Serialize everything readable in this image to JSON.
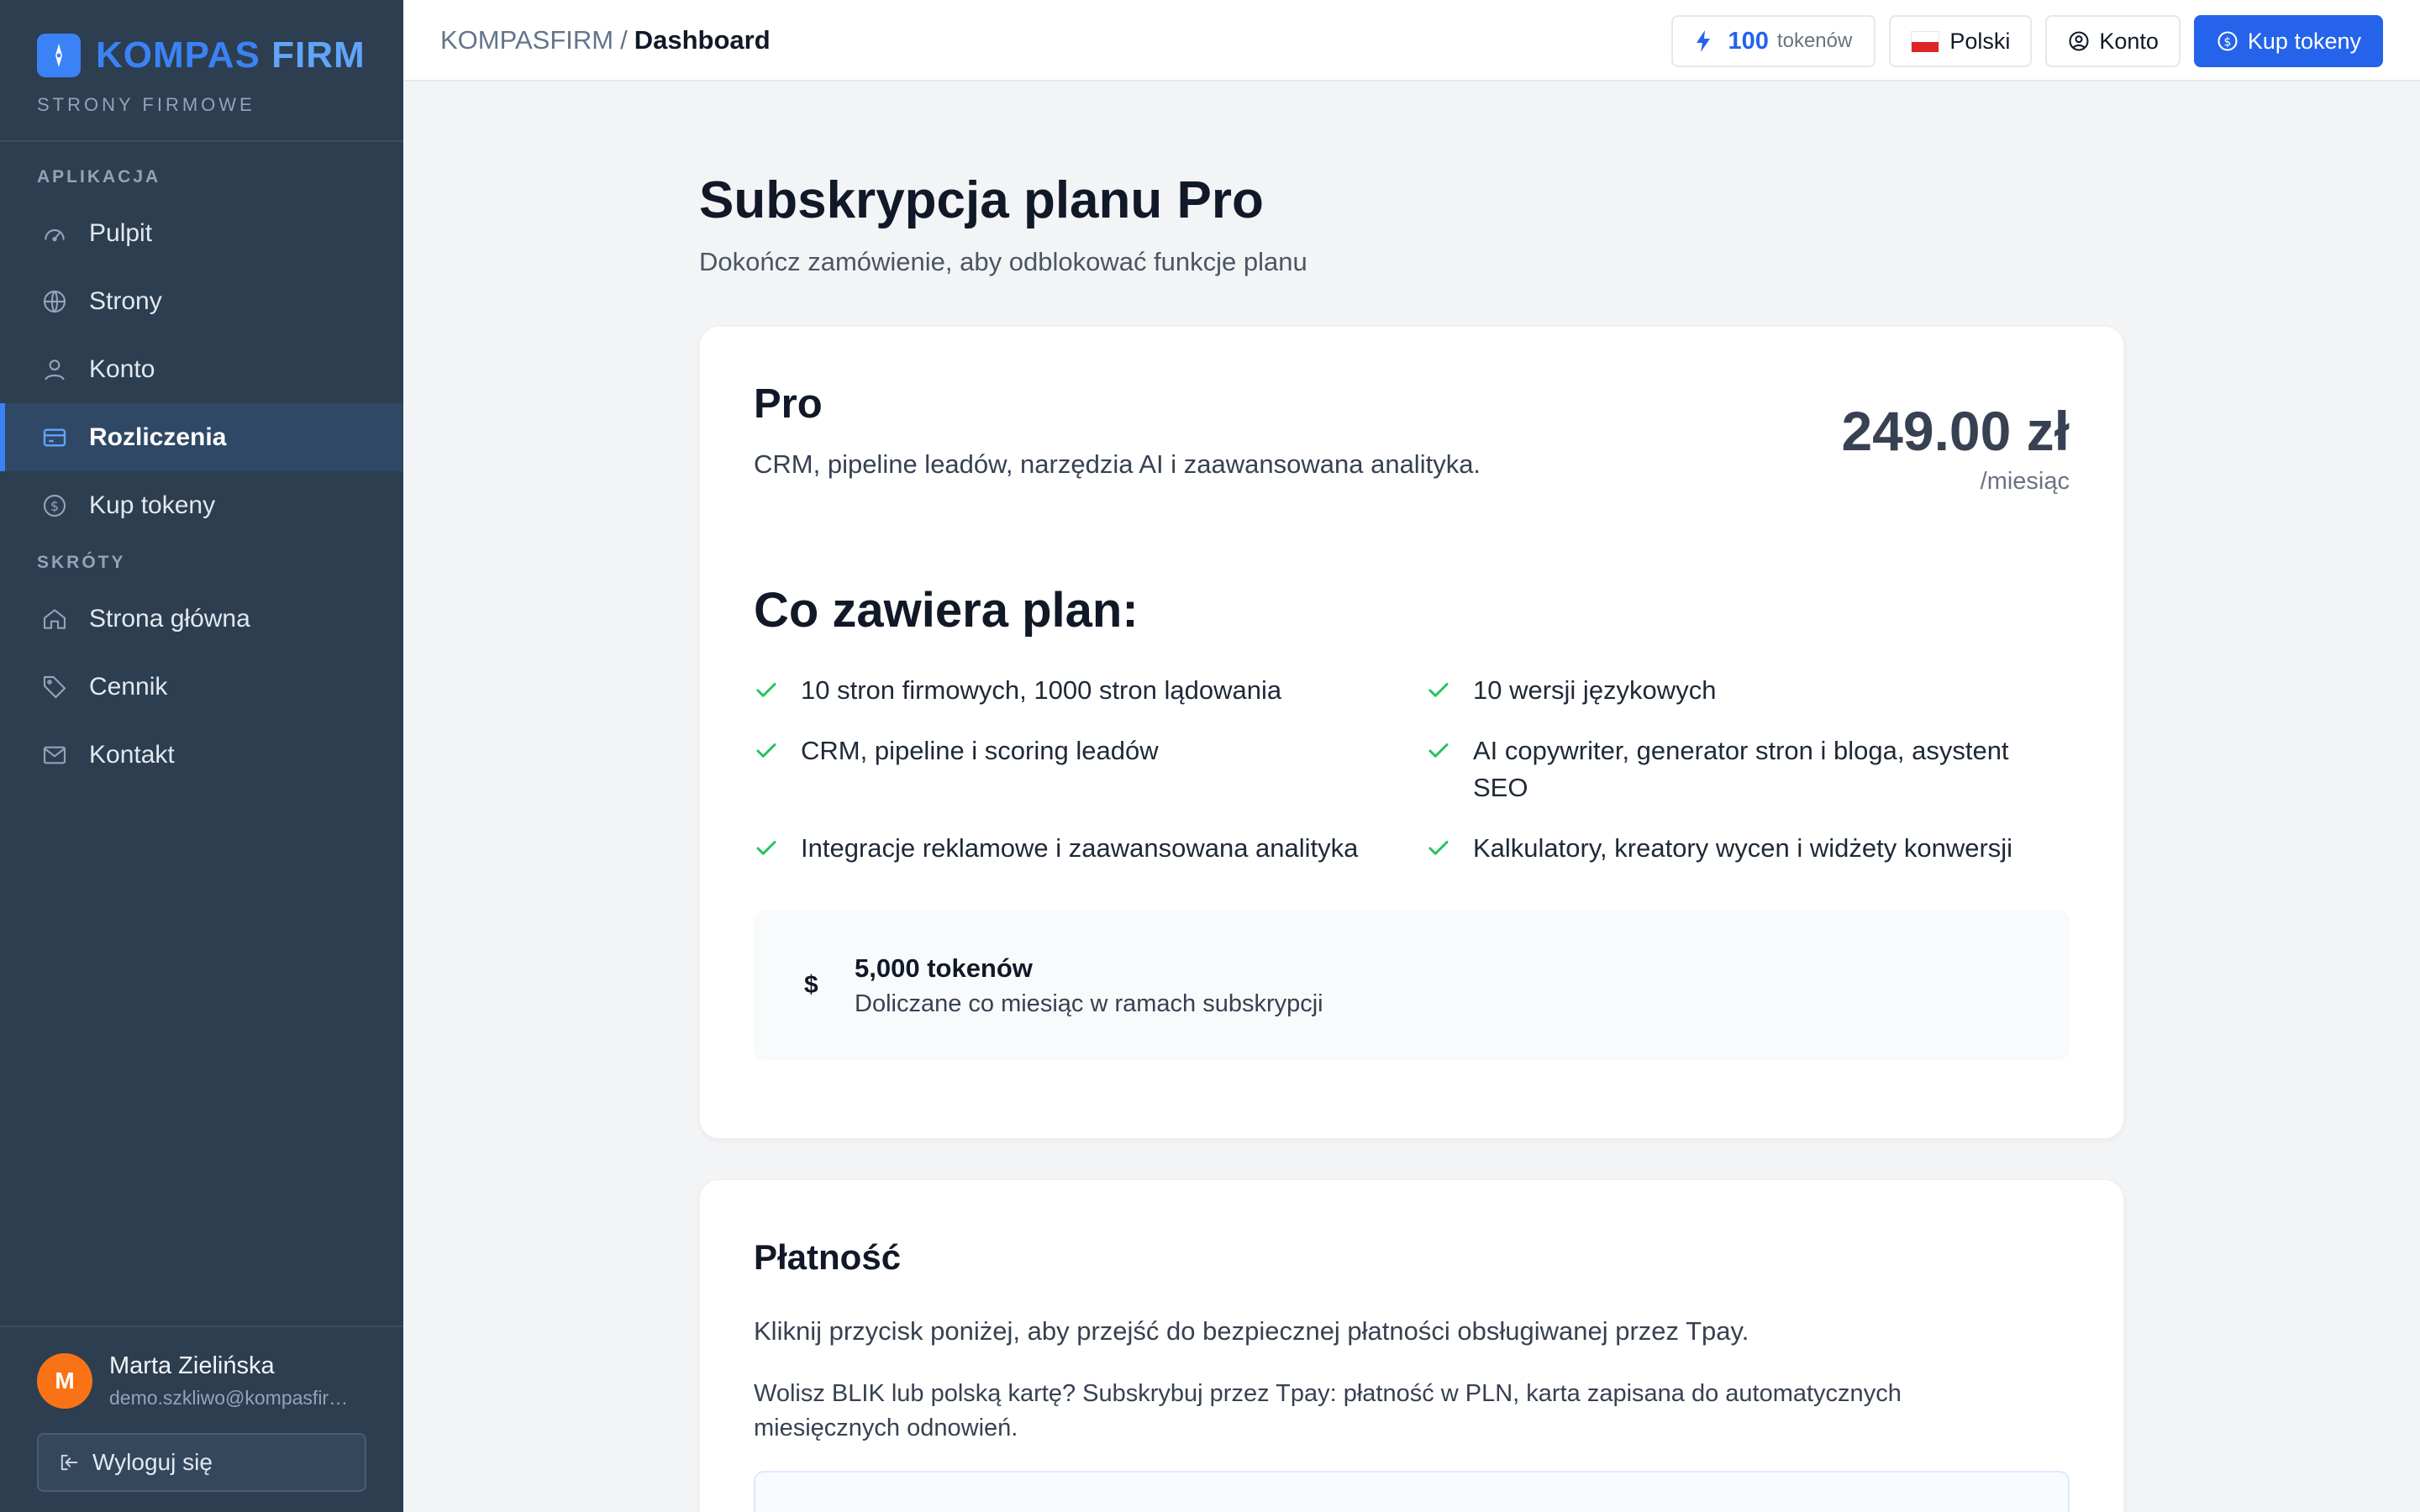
{
  "sidebar": {
    "brand_kompas": "KOMPAS",
    "brand_firm": "FIRM",
    "brand_sub": "STRONY FIRMOWE",
    "section_app": "APLIKACJA",
    "section_shortcuts": "SKRÓTY",
    "app_items": [
      {
        "label": "Pulpit",
        "icon": "gauge-icon"
      },
      {
        "label": "Strony",
        "icon": "globe-icon"
      },
      {
        "label": "Konto",
        "icon": "user-icon"
      },
      {
        "label": "Rozliczenia",
        "icon": "credit-card-icon",
        "active": true
      },
      {
        "label": "Kup tokeny",
        "icon": "coin-icon"
      }
    ],
    "shortcut_items": [
      {
        "label": "Strona główna",
        "icon": "home-icon"
      },
      {
        "label": "Cennik",
        "icon": "tag-icon"
      },
      {
        "label": "Kontakt",
        "icon": "mail-icon"
      }
    ],
    "user": {
      "initial": "M",
      "name": "Marta Zielińska",
      "email": "demo.szkliwo@kompasfirm.pl"
    },
    "logout_label": "Wyloguj się"
  },
  "topbar": {
    "crumb_root": "KOMPASFIRM",
    "crumb_sep": "/",
    "crumb_current": "Dashboard",
    "tokens_count": "100",
    "tokens_unit": "tokenów",
    "language": "Polski",
    "account": "Konto",
    "buy_tokens": "Kup tokeny"
  },
  "page": {
    "title": "Subskrypcja planu Pro",
    "subtitle": "Dokończ zamówienie, aby odblokować funkcje planu"
  },
  "plan": {
    "name": "Pro",
    "description": "CRM, pipeline leadów, narzędzia AI i zaawansowana analityka.",
    "price": "249.00 zł",
    "period": "/miesiąc",
    "includes_title": "Co zawiera plan:",
    "features": [
      "10 stron firmowych, 1000 stron lądowania",
      "10 wersji językowych",
      "CRM, pipeline i scoring leadów",
      "AI copywriter, generator stron i bloga, asystent SEO",
      "Integracje reklamowe i zaawansowana analityka",
      "Kalkulatory, kreatory wycen i widżety konwersji"
    ],
    "tokens_symbol": "$",
    "tokens_title": "5,000 tokenów",
    "tokens_sub": "Doliczane co miesiąc w ramach subskrypcji"
  },
  "payment": {
    "title": "Płatność",
    "text": "Kliknij przycisk poniżej, aby przejść do bezpiecznej płatności obsługiwanej przez Tpay.",
    "text2": "Wolisz BLIK lub polską kartę? Subskrybuj przez Tpay: płatność w PLN, karta zapisana do automatycznych miesięcznych odnowień."
  },
  "colors": {
    "sidebar_bg": "#2c3e50",
    "accent": "#2563eb",
    "check": "#22c55e",
    "avatar": "#f97316"
  }
}
